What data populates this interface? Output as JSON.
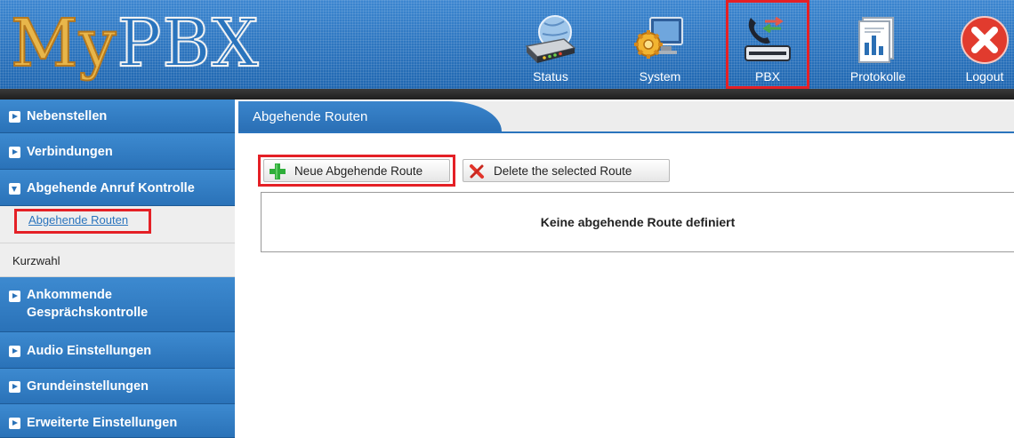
{
  "header": {
    "logo_my": "My",
    "logo_pbx": "PBX",
    "nav": [
      {
        "label": "Status",
        "icon": "router-icon"
      },
      {
        "label": "System",
        "icon": "system-monitor-icon"
      },
      {
        "label": "PBX",
        "icon": "pbx-phone-icon",
        "active": true
      },
      {
        "label": "Protokolle",
        "icon": "report-document-icon"
      },
      {
        "label": "Logout",
        "icon": "logout-x-icon"
      }
    ]
  },
  "sidebar": {
    "items": [
      {
        "label": "Nebenstellen"
      },
      {
        "label": "Verbindungen"
      },
      {
        "label": "Abgehende Anruf Kontrolle",
        "expanded": true
      },
      {
        "label": "Ankommende"
      },
      {
        "label": "Gesprächskontrolle"
      },
      {
        "label": "Audio Einstellungen"
      },
      {
        "label": "Grundeinstellungen"
      },
      {
        "label": "Erweiterte Einstellungen"
      }
    ],
    "sub_items": [
      {
        "label": "Abgehende Routen",
        "active": true
      },
      {
        "label": "Kurzwahl"
      }
    ]
  },
  "main": {
    "tab_label": "Abgehende Routen",
    "buttons": {
      "new_route": "Neue Abgehende Route",
      "delete_route": "Delete the selected Route"
    },
    "empty_message": "Keine abgehende Route definiert"
  },
  "colors": {
    "accent_blue": "#2a74bd",
    "highlight_red": "#e42026"
  }
}
